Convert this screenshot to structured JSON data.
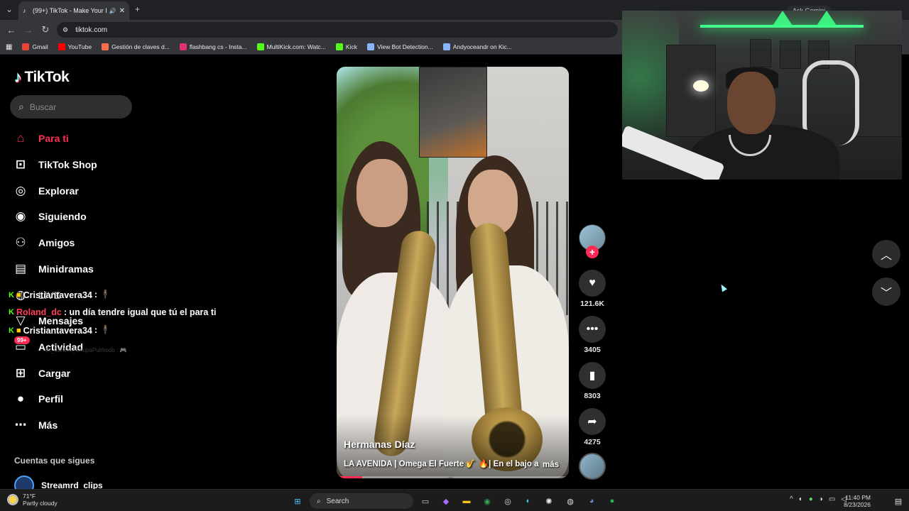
{
  "browser": {
    "tab_title": "(99+) TikTok - Make Your D...",
    "url": "tiktok.com",
    "ask_gemini": "Ask Gemini",
    "bookmarks": [
      {
        "label": "Gmail",
        "color": "#ea4335"
      },
      {
        "label": "YouTube",
        "color": "#ff0000"
      },
      {
        "label": "Gestión de claves d...",
        "color": "#ff6d4a"
      },
      {
        "label": "flashbang cs - Insta...",
        "color": "#e1306c"
      },
      {
        "label": "MultiKick.com: Watc...",
        "color": "#53fc18"
      },
      {
        "label": "Kick",
        "color": "#53fc18"
      },
      {
        "label": "View Bot Detection...",
        "color": "#8ab4f8"
      },
      {
        "label": "Andyoceandr on Kic...",
        "color": "#8ab4f8"
      }
    ]
  },
  "sidebar": {
    "logo_text": "TikTok",
    "search_placeholder": "Buscar",
    "items": [
      {
        "label": "Para ti",
        "icon": "home-icon"
      },
      {
        "label": "TikTok Shop",
        "icon": "shop-icon"
      },
      {
        "label": "Explorar",
        "icon": "compass-icon"
      },
      {
        "label": "Siguiendo",
        "icon": "avatar-icon"
      },
      {
        "label": "Amigos",
        "icon": "friends-icon"
      },
      {
        "label": "Minidramas",
        "icon": "film-icon"
      },
      {
        "label": "LIVE",
        "icon": "live-icon"
      },
      {
        "label": "Mensajes",
        "icon": "message-icon"
      },
      {
        "label": "Actividad",
        "icon": "inbox-icon"
      },
      {
        "label": "Cargar",
        "icon": "plus-square-icon"
      },
      {
        "label": "Perfil",
        "icon": "profile-icon"
      },
      {
        "label": "Más",
        "icon": "more-icon"
      }
    ],
    "activity_badge": "99+",
    "following_title": "Cuentas que sigues",
    "following": [
      {
        "name": "Streamrd_clips"
      }
    ]
  },
  "chat": {
    "messages": [
      {
        "user": "Cristiantavera34",
        "text": ":  🕴"
      },
      {
        "user": "Roland_dc",
        "text": ": un día tendre igual que tú el para ti"
      },
      {
        "user": "Cristiantavera34",
        "text": ":  🕴"
      }
    ],
    "faded": "El_CaNiTo_ChupaPulrhodo : 🎮"
  },
  "video": {
    "author": "Hermanas Díaz",
    "description": "LA AVENIDA | Omega El Fuerte 🎷 🔥| En el bajo a",
    "more": "más",
    "progress": 0.11
  },
  "actions": {
    "likes": "121.6K",
    "comments": "3405",
    "saves": "8303",
    "shares": "4275"
  },
  "taskbar": {
    "temp": "71°F",
    "weather": "Partly cloudy",
    "search": "Search",
    "time": "11:40 PM",
    "date": "8/23/2026"
  }
}
